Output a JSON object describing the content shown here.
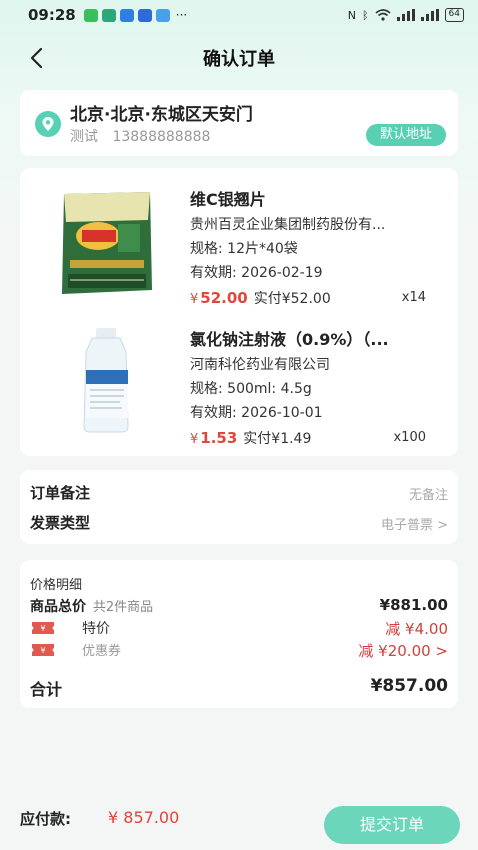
{
  "status_bar": {
    "time": "09:28",
    "battery": "64",
    "apps": [
      {
        "icon": "wechat-app-icon",
        "color": "#3bbf5a"
      },
      {
        "icon": "music-app-icon",
        "color": "#2fa67a"
      },
      {
        "icon": "cloud-app-icon",
        "color": "#2f7fe0"
      },
      {
        "icon": "k-app-icon",
        "color": "#2f6ad8"
      },
      {
        "icon": "search-app-icon",
        "color": "#4aa0e8"
      }
    ],
    "more": "···"
  },
  "header": {
    "title": "确认订单"
  },
  "address": {
    "location": "北京·北京·东城区天安门",
    "contact_name": "测试",
    "contact_phone": "13888888888",
    "default_badge": "默认地址"
  },
  "products": [
    {
      "name": "维C银翘片",
      "manufacturer": "贵州百灵企业集团制药股份有...",
      "spec": "规格:  12片*40袋",
      "expiry": "有效期:  2026-02-19",
      "price_symbol": "¥",
      "price": "52.00",
      "actual": "实付¥52.00",
      "quantity": "x14"
    },
    {
      "name": "氯化钠注射液（0.9%）（...",
      "manufacturer": "河南科伦药业有限公司",
      "spec": "规格:  500ml:  4.5g",
      "expiry": "有效期:  2026-10-01",
      "price_symbol": "¥",
      "price": "1.53",
      "actual": "实付¥1.49",
      "quantity": "x100"
    }
  ],
  "order_info": {
    "remark_label": "订单备注",
    "remark_value": "无备注",
    "invoice_label": "发票类型",
    "invoice_value": "电子普票 >"
  },
  "price_details": {
    "title": "价格明细",
    "total_label": "商品总价",
    "total_count": "共2件商品",
    "total_value": "¥881.00",
    "special_label": "特价",
    "special_value": "减 ¥4.00",
    "coupon_label": "优惠券",
    "coupon_value": "减 ¥20.00 >",
    "sum_label": "合计",
    "sum_value": "¥857.00"
  },
  "footer": {
    "pay_label": "应付款:",
    "pay_value": "¥ 857.00",
    "submit_label": "提交订单"
  },
  "colors": {
    "accent": "#58d0b4",
    "price_red": "#e0463c",
    "submit_button": "#6cd6bb"
  }
}
